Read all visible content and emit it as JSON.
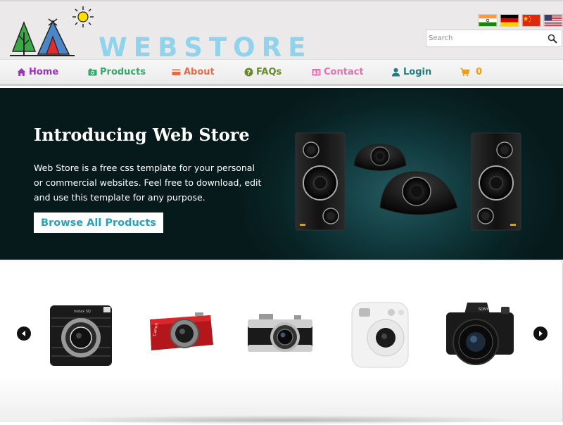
{
  "header": {
    "brand": "WEBSTORE",
    "flags": [
      "India flag",
      "Germany flag",
      "China flag",
      "USA flag"
    ],
    "search": {
      "placeholder": "Search"
    }
  },
  "nav": {
    "items": [
      {
        "label": "Home",
        "icon": "home-icon",
        "color": "#9b33b8"
      },
      {
        "label": "Products",
        "icon": "camera-icon",
        "color": "#35a86a"
      },
      {
        "label": "About",
        "icon": "card-icon",
        "color": "#e36d45"
      },
      {
        "label": "FAQs",
        "icon": "question-icon",
        "color": "#6a8a2a"
      },
      {
        "label": "Contact",
        "icon": "contact-card-icon",
        "color": "#e56fae"
      },
      {
        "label": "Login",
        "icon": "user-icon",
        "color": "#1f7d7d"
      },
      {
        "label": "0",
        "icon": "cart-icon",
        "color": "#f39c12"
      }
    ]
  },
  "hero": {
    "title": "Introducing Web Store",
    "text": "Web Store is a free css template for your personal or commercial websites. Feel free to download, edit and use this template for any purpose.",
    "button": "Browse All Products"
  },
  "carousel": {
    "products": [
      "instax-square-camera",
      "canon-red-compact-camera",
      "panasonic-mirrorless-camera",
      "instax-mini-white-camera",
      "sony-alpha-camera"
    ],
    "prev_icon": "arrow-left-icon",
    "next_icon": "arrow-right-icon"
  }
}
